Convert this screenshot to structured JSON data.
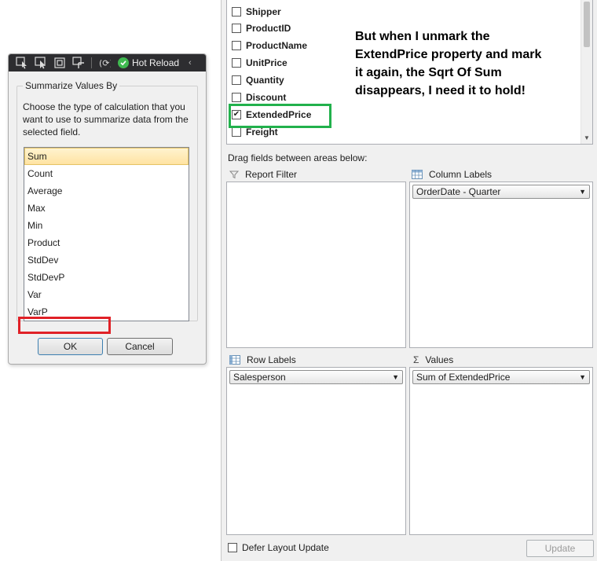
{
  "toolbar": {
    "hot_reload_label": "Hot Reload",
    "icons": [
      "select-element-icon",
      "select-pointer-icon",
      "display-layout-icon",
      "track-focus-icon",
      "binding-icon",
      "hot-reload-status-icon",
      "chevron-left-icon"
    ],
    "hot_reload_color": "#3fb950"
  },
  "dialog": {
    "group_title": "Summarize Values By",
    "description": "Choose the type of calculation that you want to use to summarize data from the selected field.",
    "items": [
      "Sum",
      "Count",
      "Average",
      "Max",
      "Min",
      "Product",
      "StdDev",
      "StdDevP",
      "Var",
      "VarP"
    ],
    "selected": "Sum",
    "ok_label": "OK",
    "cancel_label": "Cancel",
    "highlight_color": "#e02127"
  },
  "fields": {
    "items": [
      {
        "label": "Shipper",
        "checked": false
      },
      {
        "label": "ProductID",
        "checked": false
      },
      {
        "label": "ProductName",
        "checked": false
      },
      {
        "label": "UnitPrice",
        "checked": false
      },
      {
        "label": "Quantity",
        "checked": false
      },
      {
        "label": "Discount",
        "checked": false
      },
      {
        "label": "ExtendedPrice",
        "checked": true
      },
      {
        "label": "Freight",
        "checked": false
      }
    ],
    "highlight_color": "#22b14c"
  },
  "annotation": "But when I unmark the ExtendPrice property and mark it again, the Sqrt Of Sum disappears, I need it to hold!",
  "areas": {
    "drag_label": "Drag fields between areas below:",
    "report_filter": {
      "title": "Report Filter",
      "icon": "filter-icon"
    },
    "column_labels": {
      "title": "Column Labels",
      "icon": "column-grid-icon",
      "combo": "OrderDate - Quarter"
    },
    "row_labels": {
      "title": "Row Labels",
      "icon": "row-grid-icon",
      "combo": "Salesperson"
    },
    "values": {
      "title": "Values",
      "icon": "sigma-icon",
      "glyph": "Σ",
      "combo": "Sum of ExtendedPrice"
    }
  },
  "footer": {
    "defer_label": "Defer Layout Update",
    "defer_checked": false,
    "update_label": "Update"
  }
}
